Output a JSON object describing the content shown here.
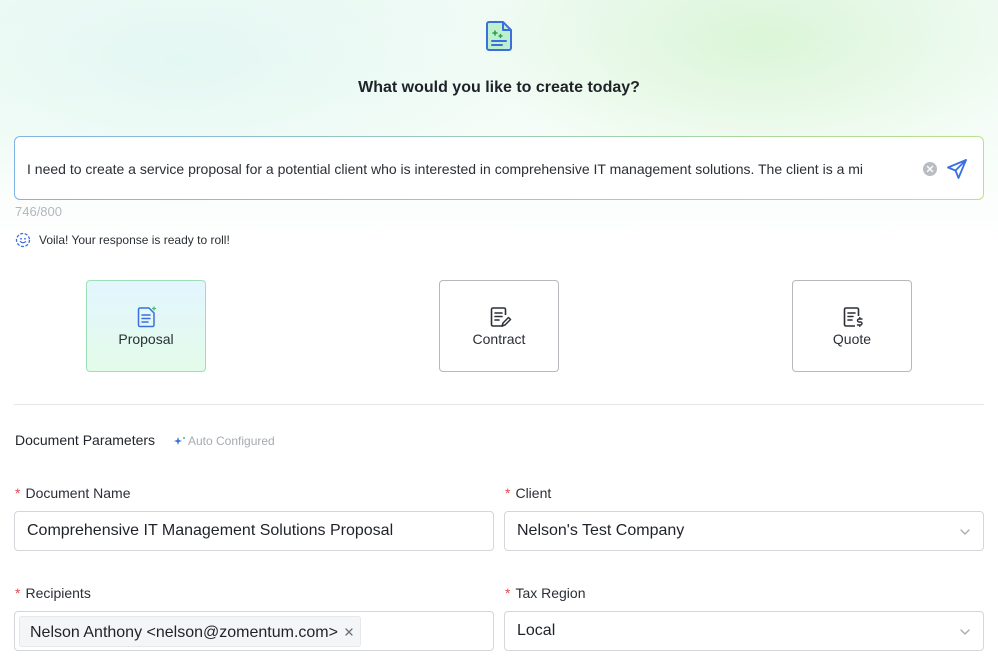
{
  "hero": {
    "icon": "document-ai-icon",
    "title": "What would you like to create today?"
  },
  "prompt": {
    "value": "I need to create a service proposal for a potential client who is interested in comprehensive IT management solutions. The client is a mi",
    "char_count": "746/800",
    "status": "Voila! Your response is ready to roll!"
  },
  "doc_types": [
    {
      "label": "Proposal",
      "icon": "proposal-icon",
      "selected": true
    },
    {
      "label": "Contract",
      "icon": "contract-icon",
      "selected": false
    },
    {
      "label": "Quote",
      "icon": "quote-icon",
      "selected": false
    }
  ],
  "parameters": {
    "title": "Document Parameters",
    "badge": "Auto Configured",
    "document_name": {
      "label": "Document Name",
      "value": "Comprehensive IT Management Solutions Proposal"
    },
    "client": {
      "label": "Client",
      "value": "Nelson's Test Company"
    },
    "recipients": {
      "label": "Recipients",
      "tag": "Nelson Anthony <nelson@zomentum.com>"
    },
    "tax_region": {
      "label": "Tax Region",
      "value": "Local"
    }
  },
  "colors": {
    "accent_blue": "#3b6fe0",
    "accent_green": "#3fbf6f",
    "required": "#e5484d"
  }
}
